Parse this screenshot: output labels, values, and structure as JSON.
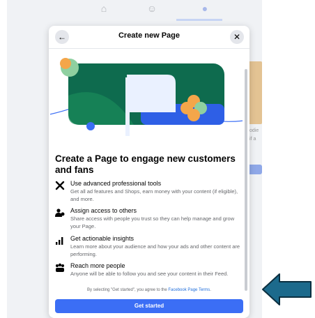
{
  "modal": {
    "title": "Create new Page",
    "back_icon": "arrow-left-icon",
    "close_icon": "close-icon",
    "headline": "Create a Page to engage new customers and fans",
    "features": [
      {
        "icon": "tools-icon",
        "title": "Use advanced professional tools",
        "description": "Get all ad features and Shops, earn money with your content (if eligible), and more."
      },
      {
        "icon": "people-access-icon",
        "title": "Assign access to others",
        "description": "Share access with people you trust so they can help manage and grow your Page."
      },
      {
        "icon": "insights-chart-icon",
        "title": "Get actionable insights",
        "description": "Learn more about your audience and how your ads and other content are performing."
      },
      {
        "icon": "audience-icon",
        "title": "Reach more people",
        "description": "Anyone will be able to follow you and see your content in their Feed."
      }
    ],
    "terms_prefix": "By selecting \"Get started\", you agree to the ",
    "terms_link": "Facebook Page Terms",
    "terms_suffix": ".",
    "cta_label": "Get started"
  },
  "background": {
    "nav_icons": [
      "home-icon",
      "friends-icon",
      "groups-icon"
    ],
    "card_text_1": "odie",
    "card_text_2": "if a"
  },
  "annotation": {
    "arrow_color": "#1c6a8c",
    "arrow_icon": "left-arrow-annotation-icon"
  },
  "colors": {
    "accent": "#3b6ef5",
    "link": "#216fdb",
    "hero_green": "#0e6b4e",
    "hero_blue": "#2e5fe6"
  }
}
